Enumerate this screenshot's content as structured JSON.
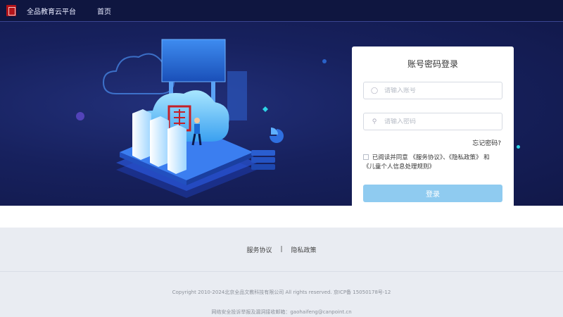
{
  "header": {
    "brand": "全品教育云平台",
    "nav_home": "首页"
  },
  "login": {
    "title": "账号密码登录",
    "account_placeholder": "请输入账号",
    "password_placeholder": "请输入密码",
    "forgot": "忘记密码?",
    "agree_prefix": "已阅读并同意",
    "service_link": "《服务协议》",
    "separator": "、",
    "privacy_link": "《隐私政策》",
    "and": "和",
    "children_link": "《儿童个人信息处理规则》",
    "submit": "登录"
  },
  "footer": {
    "service": "服务协议",
    "divider": "|",
    "privacy": "隐私政策",
    "copyright": "Copyright 2010-2024北京全品文教科技有限公司 All rights reserved. 京ICP备 15050178号-12",
    "report": "网络安全投诉举报及漏洞接收邮箱：gaohaifeng@canpoint.cn"
  },
  "colors": {
    "topbar": "#0f1640",
    "hero": "#17215e",
    "button": "#8fcbf0",
    "logo": "#b3141a"
  }
}
